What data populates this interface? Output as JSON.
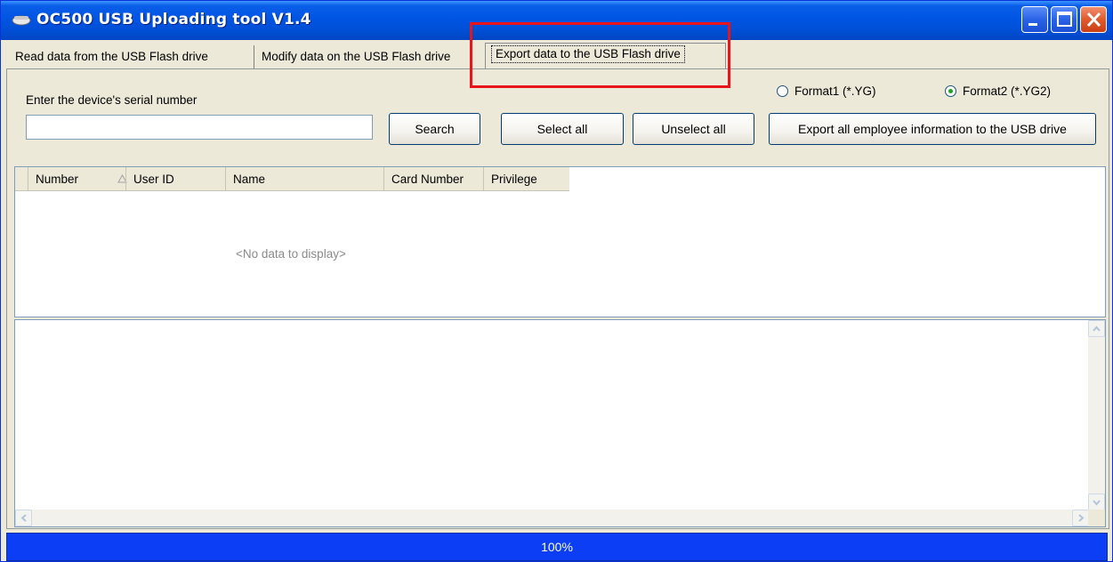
{
  "window": {
    "title": "OC500 USB Uploading tool V1.4"
  },
  "tabs": [
    {
      "label": "Read data from the USB Flash drive"
    },
    {
      "label": "Modify data on the USB Flash drive"
    },
    {
      "label": "Export data to the USB Flash drive"
    }
  ],
  "export_tab": {
    "serial_label": "Enter the device's serial number",
    "serial_value": "",
    "search_button": "Search",
    "select_all_button": "Select all",
    "unselect_all_button": "Unselect all",
    "export_button": "Export all employee information to the USB drive",
    "format1_label": "Format1 (*.YG)",
    "format2_label": "Format2 (*.YG2)",
    "selected_format": "Format2"
  },
  "grid": {
    "columns": [
      "Number",
      "User ID",
      "Name",
      "Card Number",
      "Privilege"
    ],
    "empty_text": "<No data to display>"
  },
  "status": {
    "progress_text": "100%",
    "progress_fraction": 1.0
  },
  "colors": {
    "titlebar": "#0054e3",
    "highlight": "#e8141a",
    "progress": "#0b3ef5"
  }
}
